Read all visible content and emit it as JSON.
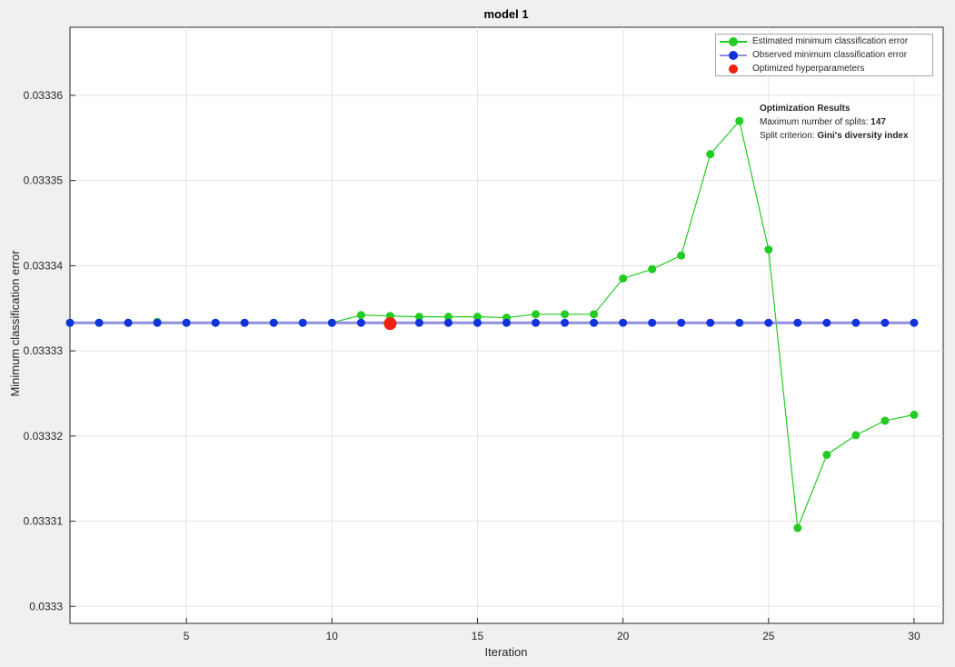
{
  "chart_data": {
    "type": "line",
    "title": "model 1",
    "xlabel": "Iteration",
    "ylabel": "Minimum classification error",
    "xlim": [
      1,
      31
    ],
    "ylim": [
      0.033298,
      0.033368
    ],
    "xticks": [
      5,
      10,
      15,
      20,
      25,
      30
    ],
    "xtick_labels": [
      "5",
      "10",
      "15",
      "20",
      "25",
      "30"
    ],
    "yticks": [
      0.0333,
      0.03331,
      0.03332,
      0.03333,
      0.03334,
      0.03335,
      0.03336
    ],
    "ytick_labels": [
      "0.0333",
      "0.03331",
      "0.03332",
      "0.03333",
      "0.03334",
      "0.03335",
      "0.03336"
    ],
    "grid": true,
    "legend_position": "top-right",
    "series": [
      {
        "name": "Estimated minimum classification error",
        "color": "#22cc22",
        "marker": "circle",
        "x": [
          1,
          2,
          3,
          4,
          5,
          6,
          7,
          8,
          9,
          10,
          11,
          12,
          13,
          14,
          15,
          16,
          17,
          18,
          19,
          20,
          21,
          22,
          23,
          24,
          25,
          26,
          27,
          28,
          29,
          30
        ],
        "values": [
          0.0333333,
          0.0333333,
          0.0333333,
          0.0333334,
          0.0333333,
          0.0333333,
          0.0333333,
          0.0333333,
          0.0333333,
          0.0333333,
          0.0333342,
          0.0333341,
          0.033334,
          0.033334,
          0.033334,
          0.0333339,
          0.0333343,
          0.0333343,
          0.0333343,
          0.0333385,
          0.0333396,
          0.0333412,
          0.0333531,
          0.033357,
          0.0333419,
          0.0333092,
          0.0333178,
          0.0333201,
          0.0333218,
          0.0333225
        ]
      },
      {
        "name": "Observed minimum classification error",
        "color": "#1133dd",
        "marker": "circle",
        "x": [
          1,
          2,
          3,
          4,
          5,
          6,
          7,
          8,
          9,
          10,
          11,
          12,
          13,
          14,
          15,
          16,
          17,
          18,
          19,
          20,
          21,
          22,
          23,
          24,
          25,
          26,
          27,
          28,
          29,
          30
        ],
        "values": [
          0.0333333,
          0.0333333,
          0.0333333,
          0.0333333,
          0.0333333,
          0.0333333,
          0.0333333,
          0.0333333,
          0.0333333,
          0.0333333,
          0.0333333,
          0.0333333,
          0.0333333,
          0.0333333,
          0.0333333,
          0.0333333,
          0.0333333,
          0.0333333,
          0.0333333,
          0.0333333,
          0.0333333,
          0.0333333,
          0.0333333,
          0.0333333,
          0.0333333,
          0.0333333,
          0.0333333,
          0.0333333,
          0.0333333,
          0.0333333
        ]
      },
      {
        "name": "Optimized hyperparameters",
        "color": "#ee2211",
        "marker": "circle",
        "x": [
          12
        ],
        "values": [
          0.0333332
        ]
      }
    ]
  },
  "results": {
    "heading": "Optimization Results",
    "line1_label": "Maximum number of splits:",
    "line1_value": "147",
    "line2_label": "Split criterion:",
    "line2_value": "Gini's diversity index"
  }
}
